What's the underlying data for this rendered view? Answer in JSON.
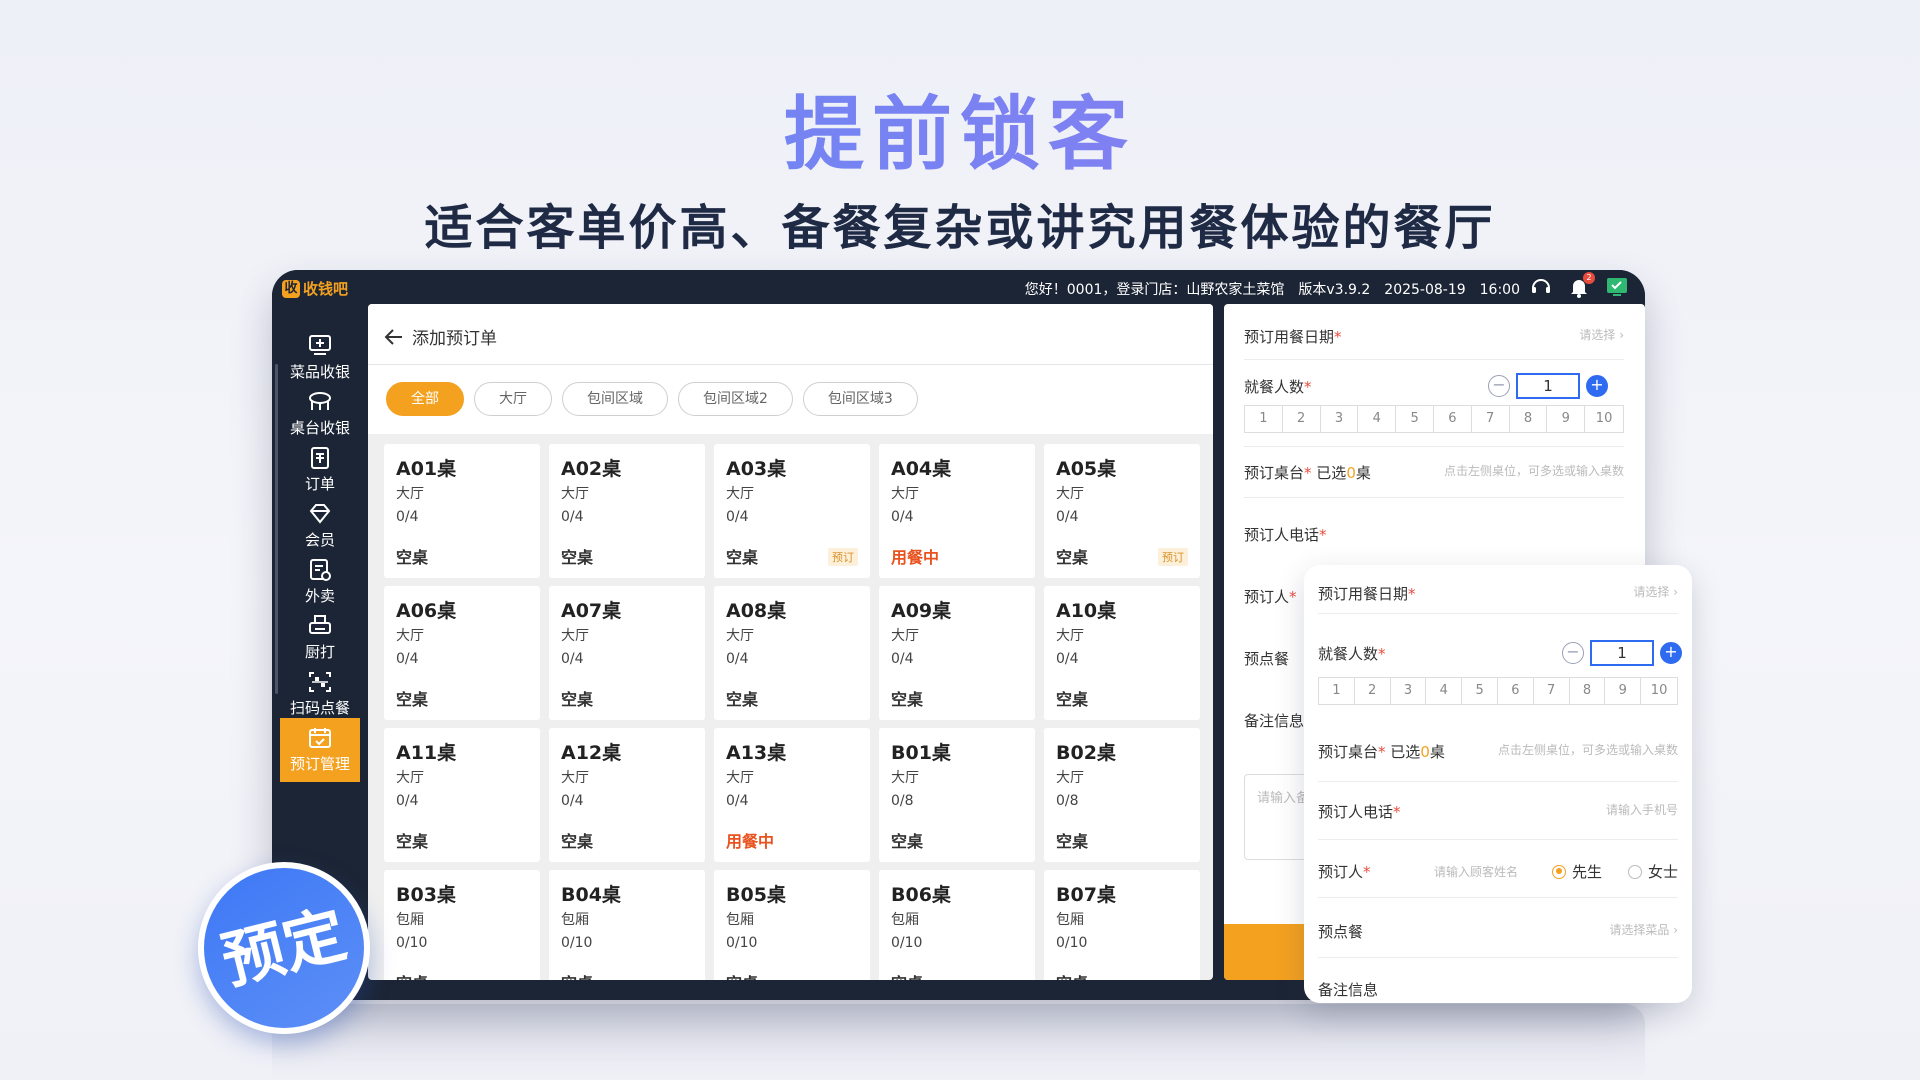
{
  "hero": {
    "title": "提前锁客",
    "subtitle": "适合客单价高、备餐复杂或讲究用餐体验的餐厅"
  },
  "topbar": {
    "logo_mark": "收",
    "logo_text": "收钱吧",
    "info": "您好！0001，登录门店：山野农家土菜馆　版本v3.9.2　2025-08-19　16:00",
    "notification_count": "2"
  },
  "sidebar": {
    "items": [
      {
        "label": "菜品收银",
        "icon": "dish-cashier-icon"
      },
      {
        "label": "桌台收银",
        "icon": "table-cashier-icon"
      },
      {
        "label": "订单",
        "icon": "order-icon"
      },
      {
        "label": "会员",
        "icon": "member-icon"
      },
      {
        "label": "外卖",
        "icon": "takeout-icon"
      },
      {
        "label": "厨打",
        "icon": "kitchen-print-icon"
      },
      {
        "label": "扫码点餐",
        "icon": "qr-order-icon"
      },
      {
        "label": "预订管理",
        "icon": "reservation-icon",
        "active": true
      }
    ]
  },
  "panel": {
    "back_title": "添加预订单",
    "chips": [
      "全部",
      "大厅",
      "包间区域",
      "包间区域2",
      "包间区域3"
    ]
  },
  "tables": [
    {
      "name": "A01桌",
      "area": "大厅",
      "cap": "0/4",
      "status": "空桌",
      "tag": ""
    },
    {
      "name": "A02桌",
      "area": "大厅",
      "cap": "0/4",
      "status": "空桌",
      "tag": ""
    },
    {
      "name": "A03桌",
      "area": "大厅",
      "cap": "0/4",
      "status": "空桌",
      "tag": "预订"
    },
    {
      "name": "A04桌",
      "area": "大厅",
      "cap": "0/4",
      "status": "用餐中",
      "tag": ""
    },
    {
      "name": "A05桌",
      "area": "大厅",
      "cap": "0/4",
      "status": "空桌",
      "tag": "预订"
    },
    {
      "name": "A06桌",
      "area": "大厅",
      "cap": "0/4",
      "status": "空桌",
      "tag": ""
    },
    {
      "name": "A07桌",
      "area": "大厅",
      "cap": "0/4",
      "status": "空桌",
      "tag": ""
    },
    {
      "name": "A08桌",
      "area": "大厅",
      "cap": "0/4",
      "status": "空桌",
      "tag": ""
    },
    {
      "name": "A09桌",
      "area": "大厅",
      "cap": "0/4",
      "status": "空桌",
      "tag": ""
    },
    {
      "name": "A10桌",
      "area": "大厅",
      "cap": "0/4",
      "status": "空桌",
      "tag": ""
    },
    {
      "name": "A11桌",
      "area": "大厅",
      "cap": "0/4",
      "status": "空桌",
      "tag": ""
    },
    {
      "name": "A12桌",
      "area": "大厅",
      "cap": "0/4",
      "status": "空桌",
      "tag": ""
    },
    {
      "name": "A13桌",
      "area": "大厅",
      "cap": "0/4",
      "status": "用餐中",
      "tag": ""
    },
    {
      "name": "B01桌",
      "area": "大厅",
      "cap": "0/8",
      "status": "空桌",
      "tag": ""
    },
    {
      "name": "B02桌",
      "area": "大厅",
      "cap": "0/8",
      "status": "空桌",
      "tag": ""
    },
    {
      "name": "B03桌",
      "area": "包厢",
      "cap": "0/10",
      "status": "空桌",
      "tag": ""
    },
    {
      "name": "B04桌",
      "area": "包厢",
      "cap": "0/10",
      "status": "空桌",
      "tag": ""
    },
    {
      "name": "B05桌",
      "area": "包厢",
      "cap": "0/10",
      "status": "空桌",
      "tag": ""
    },
    {
      "name": "B06桌",
      "area": "包厢",
      "cap": "0/10",
      "status": "空桌",
      "tag": ""
    },
    {
      "name": "B07桌",
      "area": "包厢",
      "cap": "0/10",
      "status": "空桌",
      "tag": ""
    }
  ],
  "form": {
    "date_label": "预订用餐日期",
    "date_hint": "请选择",
    "guests_label": "就餐人数",
    "guests_value": "1",
    "guest_numbers": [
      "1",
      "2",
      "3",
      "4",
      "5",
      "6",
      "7",
      "8",
      "9",
      "10"
    ],
    "table_label": "预订桌台",
    "table_selected_prefix": "已选",
    "table_selected_count": "0",
    "table_selected_suffix": "桌",
    "table_hint": "点击左侧桌位，可多选或输入桌数",
    "phone_label": "预订人电话",
    "phone_hint": "请输入手机号",
    "person_label": "预订人",
    "person_hint": "请输入顾客姓名",
    "gender_male": "先生",
    "gender_female": "女士",
    "preorder_label": "预点餐",
    "preorder_hint": "请选择菜品",
    "remark_label": "备注信息",
    "remark_placeholder": "请输入备注"
  },
  "badge": {
    "label": "预定"
  },
  "colors": {
    "accent": "#f4a120",
    "primary_blue": "#2f6bf0",
    "busy": "#e8531f",
    "dark": "#1c2535"
  }
}
